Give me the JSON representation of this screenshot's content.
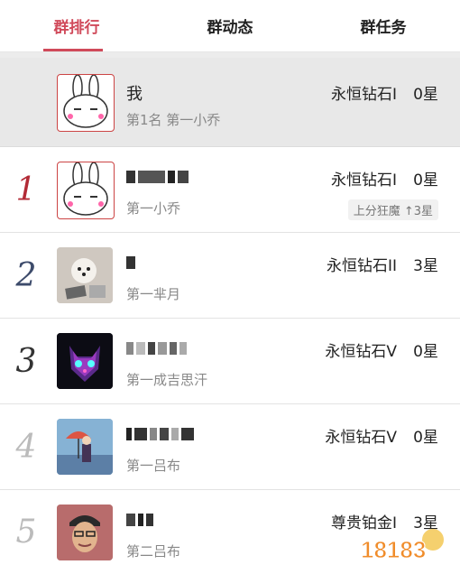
{
  "tabs": [
    "群排行",
    "群动态",
    "群任务"
  ],
  "me": {
    "name": "我",
    "sub": "第1名 第一小乔",
    "tier": "永恒钻石I",
    "stars": "0星"
  },
  "rows": [
    {
      "rank": "1",
      "sub": "第一小乔",
      "tier": "永恒钻石I",
      "stars": "0星",
      "badge": "上分狂魔 ↑3星"
    },
    {
      "rank": "2",
      "sub": "第一芈月",
      "tier": "永恒钻石II",
      "stars": "3星"
    },
    {
      "rank": "3",
      "sub": "第一成吉思汗",
      "tier": "永恒钻石V",
      "stars": "0星"
    },
    {
      "rank": "4",
      "sub": "第一吕布",
      "tier": "永恒钻石V",
      "stars": "0星"
    },
    {
      "rank": "5",
      "sub": "第二吕布",
      "tier": "尊贵铂金I",
      "stars": "3星"
    }
  ],
  "watermark": "18183",
  "colors": {
    "accent": "#d04a5a"
  }
}
